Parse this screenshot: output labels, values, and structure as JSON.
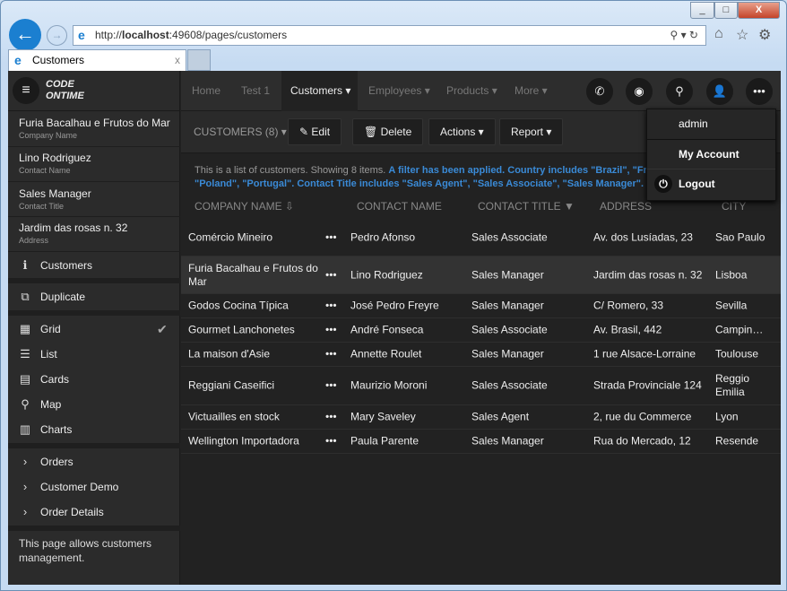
{
  "browser": {
    "url_prefix": "http://",
    "url_host": "localhost",
    "url_rest": ":49608/pages/customers",
    "tab_title": "Customers",
    "tab_close": "x"
  },
  "app": {
    "logo": "CODE ONTIME",
    "nav": [
      "Home",
      "Test 1",
      "Customers ▾",
      "Employees ▾",
      "Products ▾",
      "More ▾"
    ],
    "context": [
      {
        "t": "Furia Bacalhau e Frutos do Mar",
        "s": "Company Name"
      },
      {
        "t": "Lino Rodriguez",
        "s": "Contact Name"
      },
      {
        "t": "Sales Manager",
        "s": "Contact Title"
      },
      {
        "t": "Jardim das rosas n. 32",
        "s": "Address"
      }
    ],
    "menu": {
      "customers": "Customers",
      "duplicate": "Duplicate",
      "grid": "Grid",
      "list": "List",
      "cards": "Cards",
      "map": "Map",
      "charts": "Charts",
      "orders": "Orders",
      "customer_demo": "Customer Demo",
      "order_details": "Order Details"
    },
    "side_note": "This page allows customers management.",
    "toolbar": {
      "title": "CUSTOMERS (8) ▾",
      "edit": "Edit",
      "delete": "Delete",
      "actions": "Actions ▾",
      "report": "Report ▾"
    },
    "info_plain": "This is a list of customers. Showing 8 items. ",
    "info_filter": "A filter has been applied. Country includes \"Brazil\", \"Fra",
    "info_filter2": "\"Poland\", \"Portugal\". Contact Title includes \"Sales Agent\", \"Sales Associate\", \"Sales Manager\".",
    "columns": [
      "COMPANY NAME ⇩",
      "CONTACT NAME",
      "CONTACT TITLE ▼",
      "ADDRESS",
      "CITY"
    ],
    "rows": [
      [
        "Comércio Mineiro",
        "Pedro Afonso",
        "Sales Associate",
        "Av. dos Lusíadas, 23",
        "Sao Paulo"
      ],
      [
        "Furia Bacalhau e Frutos do Mar",
        "Lino Rodriguez",
        "Sales Manager",
        "Jardim das rosas n. 32",
        "Lisboa"
      ],
      [
        "Godos Cocina Típica",
        "José Pedro Freyre",
        "Sales Manager",
        "C/ Romero, 33",
        "Sevilla"
      ],
      [
        "Gourmet Lanchonetes",
        "André Fonseca",
        "Sales Associate",
        "Av. Brasil, 442",
        "Campin…"
      ],
      [
        "La maison d'Asie",
        "Annette Roulet",
        "Sales Manager",
        "1 rue Alsace-Lorraine",
        "Toulouse"
      ],
      [
        "Reggiani Caseifici",
        "Maurizio Moroni",
        "Sales Associate",
        "Strada Provinciale 124",
        "Reggio Emilia"
      ],
      [
        "Victuailles en stock",
        "Mary Saveley",
        "Sales Agent",
        "2, rue du Commerce",
        "Lyon"
      ],
      [
        "Wellington Importadora",
        "Paula Parente",
        "Sales Manager",
        "Rua do Mercado, 12",
        "Resende"
      ]
    ],
    "row_menu": "•••",
    "user_menu": {
      "user": "admin",
      "account": "My Account",
      "logout": "Logout"
    }
  }
}
